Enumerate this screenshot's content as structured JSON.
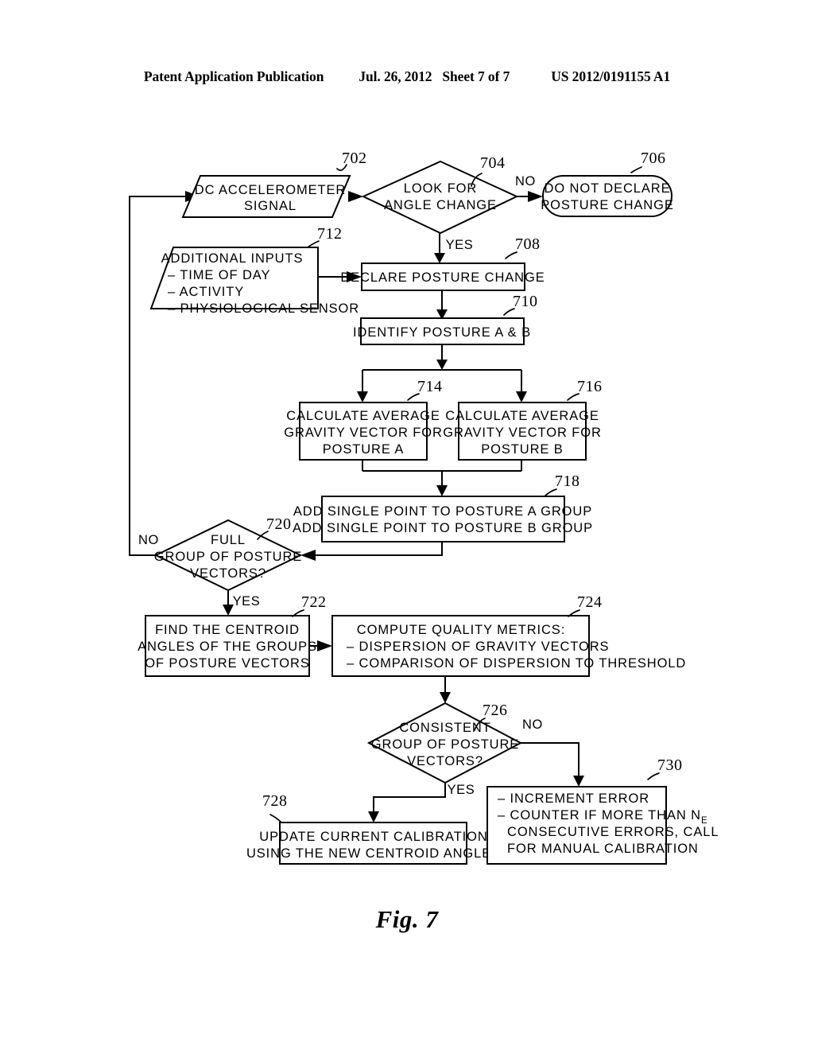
{
  "header": {
    "title": "Patent Application Publication",
    "date": "Jul. 26, 2012",
    "sheet": "Sheet 7 of 7",
    "publication_number": "US 2012/0191155 A1"
  },
  "figure": {
    "caption": "Fig. 7"
  },
  "colors": {
    "ink": "#000000",
    "paper": "#ffffff"
  },
  "nodes": {
    "n702": {
      "ref": "702",
      "shape": "parallelogram",
      "lines": [
        "DC ACCELEROMETER",
        "SIGNAL"
      ]
    },
    "n704": {
      "ref": "704",
      "shape": "diamond",
      "lines": [
        "LOOK FOR",
        "ANGLE CHANGE"
      ]
    },
    "n706": {
      "ref": "706",
      "shape": "stadium",
      "lines": [
        "DO NOT DECLARE",
        "POSTURE CHANGE"
      ]
    },
    "n708": {
      "ref": "708",
      "shape": "rect",
      "lines": [
        "DECLARE POSTURE CHANGE"
      ]
    },
    "n710": {
      "ref": "710",
      "shape": "rect",
      "lines": [
        "IDENTIFY POSTURE A & B"
      ]
    },
    "n712": {
      "ref": "712",
      "shape": "parallelogram",
      "title": "ADDITIONAL INPUTS",
      "lines": [
        "–  TIME OF DAY",
        "–  ACTIVITY",
        "–  PHYSIOLOGICAL SENSOR"
      ]
    },
    "n714": {
      "ref": "714",
      "shape": "rect",
      "lines": [
        "CALCULATE AVERAGE",
        "GRAVITY VECTOR FOR",
        "POSTURE A"
      ]
    },
    "n716": {
      "ref": "716",
      "shape": "rect",
      "lines": [
        "CALCULATE AVERAGE",
        "GRAVITY VECTOR FOR",
        "POSTURE B"
      ]
    },
    "n718": {
      "ref": "718",
      "shape": "rect",
      "lines": [
        "ADD SINGLE POINT TO POSTURE A GROUP",
        "ADD SINGLE POINT TO POSTURE B GROUP"
      ]
    },
    "n720": {
      "ref": "720",
      "shape": "diamond",
      "lines": [
        "FULL",
        "GROUP OF POSTURE",
        "VECTORS?"
      ]
    },
    "n722": {
      "ref": "722",
      "shape": "rect",
      "lines": [
        "FIND THE CENTROID",
        "ANGLES OF THE GROUPS",
        "OF POSTURE VECTORS"
      ]
    },
    "n724": {
      "ref": "724",
      "shape": "rect",
      "title": "COMPUTE QUALITY METRICS:",
      "lines": [
        "–  DISPERSION OF GRAVITY VECTORS",
        "–  COMPARISON OF DISPERSION TO THRESHOLD"
      ]
    },
    "n726": {
      "ref": "726",
      "shape": "diamond",
      "lines": [
        "CONSISTENT",
        "GROUP OF POSTURE",
        "VECTORS?"
      ]
    },
    "n728": {
      "ref": "728",
      "shape": "rect",
      "lines": [
        "UPDATE CURRENT CALIBRATION",
        "USING THE NEW CENTROID ANGLES"
      ]
    },
    "n730": {
      "ref": "730",
      "shape": "rect",
      "lines": [
        "–  INCREMENT ERROR",
        "–  COUNTER IF MORE THAN N",
        "CONSECUTIVE ERRORS, CALL",
        "FOR MANUAL CALIBRATION"
      ],
      "subscript": "E"
    }
  },
  "edge_labels": {
    "e704_no": "NO",
    "e704_yes": "YES",
    "e720_no": "NO",
    "e720_yes": "YES",
    "e726_no": "NO",
    "e726_yes": "YES"
  }
}
